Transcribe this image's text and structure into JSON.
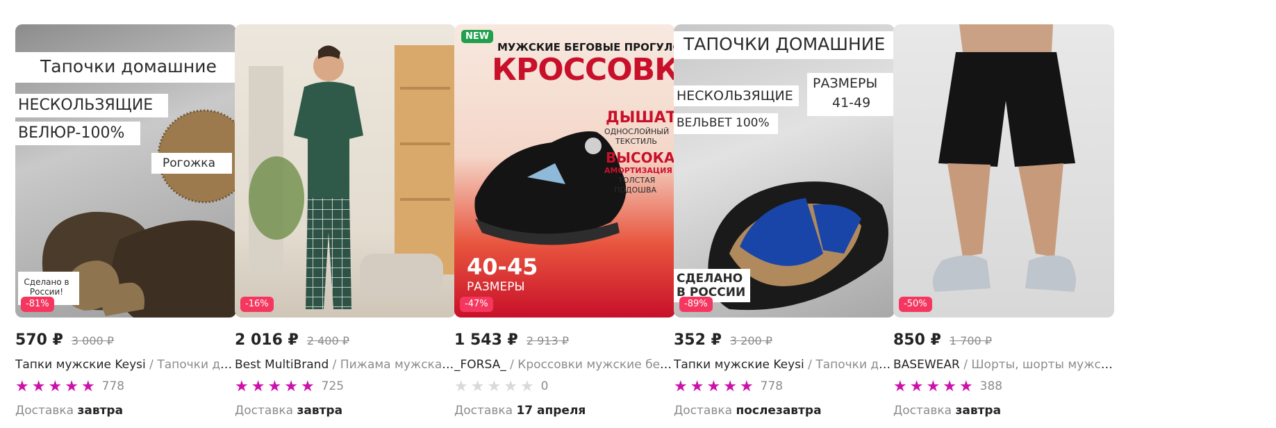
{
  "colors": {
    "discount_badge": "#f5375f",
    "star_active": "#cb11ab",
    "star_inactive": "#d9d9d9",
    "muted_text": "#8b8b8b",
    "new_badge": "#20a04c"
  },
  "products": [
    {
      "price": "570 ₽",
      "old_price": "3 000 ₽",
      "brand": "Тапки мужские Keysi",
      "separator": " / ",
      "name": "Тапочки домашние нескользящие",
      "rating_stars": 5,
      "reviews": "778",
      "delivery_label": "Доставка",
      "delivery_value": "завтра",
      "discount": "-81%",
      "image_text": {
        "headline": "Тапочки домашние",
        "line1": "НЕСКОЛЬЗЯЩИЕ",
        "line2": "ВЕЛЮР-100%",
        "material": "Рогожка",
        "made_in": "Сделано в России!"
      }
    },
    {
      "price": "2 016 ₽",
      "old_price": "2 400 ₽",
      "brand": "Best MultiBrand",
      "separator": " / ",
      "name": "Пижама мужская М",
      "rating_stars": 5,
      "reviews": "725",
      "delivery_label": "Доставка",
      "delivery_value": "завтра",
      "discount": "-16%"
    },
    {
      "price": "1 543 ₽",
      "old_price": "2 913 ₽",
      "brand": "_FORSA_",
      "separator": " / ",
      "name": "Кроссовки мужские беговые",
      "rating_stars": 0,
      "reviews": "0",
      "delivery_label": "Доставка",
      "delivery_value": "17 апреля",
      "discount": "-47%",
      "new_label": "NEW",
      "image_text": {
        "top": "МУЖСКИЕ  БЕГОВЫЕ ПРОГУЛОЧНЫЕ",
        "title": "КРОССОВКИ",
        "f1_title": "ДЫШАТ",
        "f1_sub1": "ОДНОСЛОЙНЫЙ",
        "f1_sub2": "ТЕКСТИЛЬ",
        "f2_title": "ВЫСОКАЯ",
        "f2_sub1": "АМОРТИЗАЦИЯ",
        "f2_sub2": "ТОЛСТАЯ",
        "f2_sub3": "ПОДОШВА",
        "sizes": "40-45",
        "sizes_label": "РАЗМЕРЫ"
      }
    },
    {
      "price": "352 ₽",
      "old_price": "3 200 ₽",
      "brand": "Тапки мужские Keysi",
      "separator": " / ",
      "name": "Тапочки домашние нескользящие",
      "rating_stars": 5,
      "reviews": "778",
      "delivery_label": "Доставка",
      "delivery_value": "послезавтра",
      "discount": "-89%",
      "image_text": {
        "headline": "ТАПОЧКИ ДОМАШНИЕ",
        "line1": "НЕСКОЛЬЗЯЩИЕ",
        "line2": "ВЕЛЬВЕТ 100%",
        "sizes_label": "РАЗМЕРЫ",
        "sizes": "41-49",
        "made_in1": "СДЕЛАНО",
        "made_in2": "В РОССИИ"
      }
    },
    {
      "price": "850 ₽",
      "old_price": "1 700 ₽",
      "brand": "BASEWEAR",
      "separator": " / ",
      "name": "Шорты, шорты мужские,",
      "rating_stars": 5,
      "reviews": "388",
      "delivery_label": "Доставка",
      "delivery_value": "завтра",
      "discount": "-50%"
    }
  ]
}
